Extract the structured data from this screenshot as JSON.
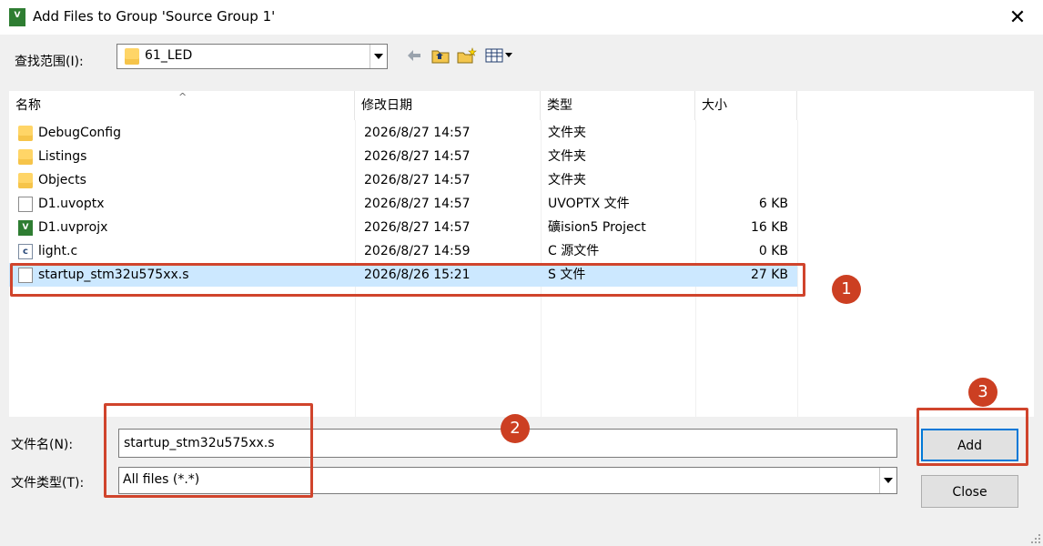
{
  "window": {
    "title": "Add Files to Group 'Source Group 1'",
    "close_glyph": "✕"
  },
  "lookin": {
    "label": "查找范围(I):",
    "value": "61_LED"
  },
  "columns": {
    "name": "名称",
    "date": "修改日期",
    "type": "类型",
    "size": "大小"
  },
  "files": [
    {
      "name": "DebugConfig",
      "date": "2026/8/27 14:57",
      "type": "文件夹",
      "size": "",
      "icon": "folder-icon"
    },
    {
      "name": "Listings",
      "date": "2026/8/27 14:57",
      "type": "文件夹",
      "size": "",
      "icon": "folder-icon"
    },
    {
      "name": "Objects",
      "date": "2026/8/27 14:57",
      "type": "文件夹",
      "size": "",
      "icon": "folder-icon"
    },
    {
      "name": "D1.uvoptx",
      "date": "2026/8/27 14:57",
      "type": "UVOPTX 文件",
      "size": "6 KB",
      "icon": "file-icon"
    },
    {
      "name": "D1.uvprojx",
      "date": "2026/8/27 14:57",
      "type": "礦ision5 Project",
      "size": "16 KB",
      "icon": "uvision-project-icon"
    },
    {
      "name": "light.c",
      "date": "2026/8/27 14:59",
      "type": "C 源文件",
      "size": "0 KB",
      "icon": "c-source-file-icon"
    },
    {
      "name": "startup_stm32u575xx.s",
      "date": "2026/8/26 15:21",
      "type": "S 文件",
      "size": "27 KB",
      "icon": "file-icon",
      "selected": true
    }
  ],
  "filename": {
    "label": "文件名(N):",
    "value": "startup_stm32u575xx.s"
  },
  "filetype": {
    "label": "文件类型(T):",
    "value": "All files (*.*)"
  },
  "buttons": {
    "add": "Add",
    "close": "Close"
  },
  "annotations": {
    "badge1": "1",
    "badge2": "2",
    "badge3": "3",
    "color": "#d0442c"
  }
}
